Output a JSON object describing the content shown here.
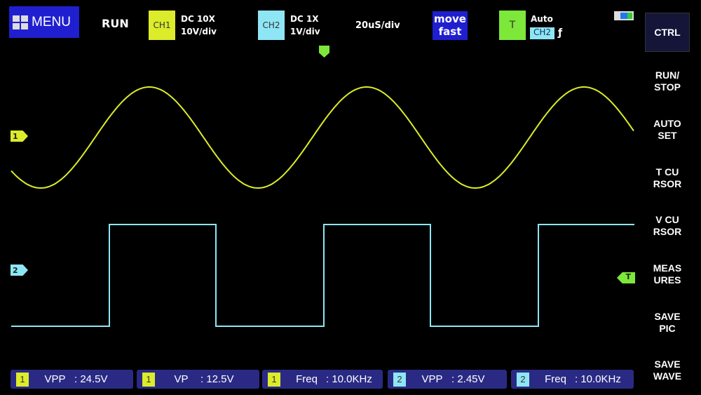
{
  "header": {
    "menu": "MENU",
    "run_state": "RUN",
    "ch1": {
      "label": "CH1",
      "coupling": "DC  10X",
      "scale": "10V/div",
      "color": "#dcec2a"
    },
    "ch2": {
      "label": "CH2",
      "coupling": "DC  1X",
      "scale": "1V/div",
      "color": "#8ee6f5"
    },
    "timebase": "20uS/div",
    "move": [
      "move",
      "fast"
    ],
    "trigger": {
      "label": "T",
      "mode": "Auto",
      "source": "CH2",
      "edge": "ƒ",
      "color": "#7de83a"
    }
  },
  "side_buttons": [
    [
      "CTRL"
    ],
    [
      "RUN/",
      "STOP"
    ],
    [
      "AUTO",
      "SET"
    ],
    [
      "T CU",
      "RSOR"
    ],
    [
      "V CU",
      "RSOR"
    ],
    [
      "MEAS",
      "URES"
    ],
    [
      "SAVE",
      "PIC"
    ],
    [
      "SAVE",
      "WAVE"
    ]
  ],
  "markers": {
    "ch1": "1",
    "ch2": "2",
    "trigger": "T"
  },
  "measurements": [
    {
      "ch": "1",
      "label": "VPP",
      "value": ": 24.5V"
    },
    {
      "ch": "1",
      "label": "VP",
      "value": ": 12.5V"
    },
    {
      "ch": "1",
      "label": "Freq",
      "value": ": 10.0KHz"
    },
    {
      "ch": "2",
      "label": "VPP",
      "value": ": 2.45V"
    },
    {
      "ch": "2",
      "label": "Freq",
      "value": ": 10.0KHz"
    }
  ]
}
